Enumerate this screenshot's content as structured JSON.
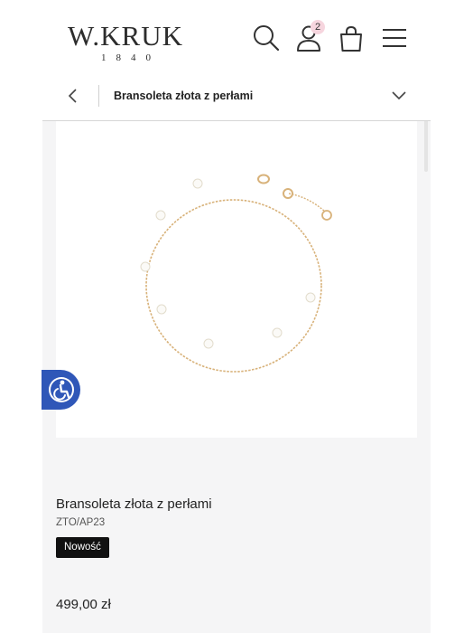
{
  "header": {
    "logo_text": "W.KRUK",
    "logo_year": "1840",
    "icons": [
      "search-icon",
      "account-icon",
      "cart-icon",
      "menu-icon"
    ],
    "cart_count": "2"
  },
  "breadcrumb": {
    "label": "Bransoleta złota z perłami"
  },
  "product": {
    "title": "Bransoleta złota z perłami",
    "sku": "ZTO/AP23",
    "badge": "Nowość",
    "price": "499,00 zł"
  },
  "colors": {
    "accessibility_button": "#2f57b8",
    "cart_badge": "#f6d5de",
    "badge_bg": "#111111"
  }
}
